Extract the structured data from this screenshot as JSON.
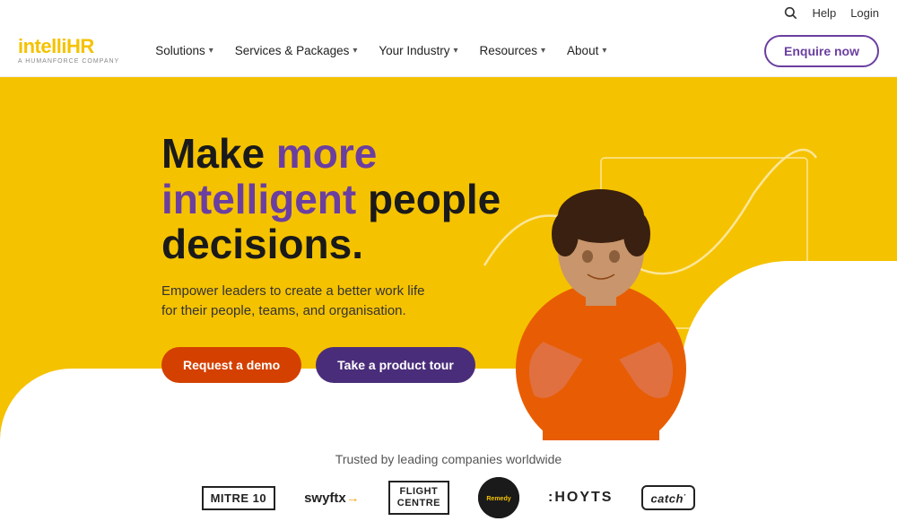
{
  "utility": {
    "search_label": "Search",
    "help_label": "Help",
    "login_label": "Login"
  },
  "nav": {
    "logo_main": "intelli",
    "logo_accent": "HR",
    "logo_sub": "A HUMANFORCE COMPANY",
    "items": [
      {
        "label": "Solutions",
        "has_dropdown": true
      },
      {
        "label": "Services & Packages",
        "has_dropdown": true
      },
      {
        "label": "Your Industry",
        "has_dropdown": true
      },
      {
        "label": "Resources",
        "has_dropdown": true
      },
      {
        "label": "About",
        "has_dropdown": true
      }
    ],
    "cta_label": "Enquire now"
  },
  "hero": {
    "headline_1": "Make ",
    "headline_highlight": "more intelligent",
    "headline_2": " people decisions.",
    "subtext": "Empower leaders to create a better work life for their people, teams, and organisation.",
    "btn_demo": "Request a demo",
    "btn_tour": "Take a product tour"
  },
  "trusted": {
    "title": "Trusted by leading companies worldwide",
    "logos": [
      {
        "name": "MITRE 10",
        "style": "bordered"
      },
      {
        "name": "swyftx→",
        "style": "plain"
      },
      {
        "name": "FLIGHT CENTRE",
        "style": "bordered"
      },
      {
        "name": "Remedy",
        "style": "circle"
      },
      {
        "name": ":HOYTS",
        "style": "plain-bold"
      },
      {
        "name": "catch·",
        "style": "catch"
      }
    ]
  }
}
